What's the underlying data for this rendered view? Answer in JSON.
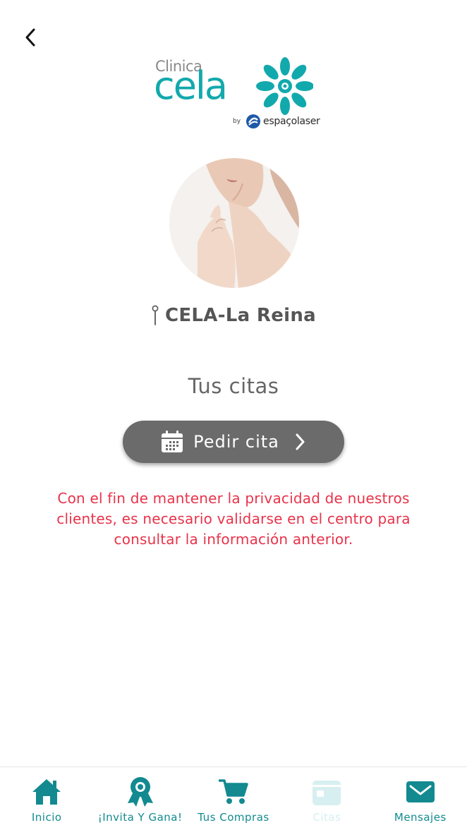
{
  "header": {
    "back_icon": "chevron-left-icon"
  },
  "logo": {
    "small_word": "Clinica",
    "big_word": "cela",
    "by": "by",
    "partner": "espaçolaser"
  },
  "clinic": {
    "pin_icon": "map-pin-icon",
    "name": "CELA-La Reina"
  },
  "appointments": {
    "title": "Tus citas",
    "button_label": "Pedir cita",
    "button_icon": "calendar-icon",
    "notice": "Con el fin de mantener la privacidad de nuestros clientes, es necesario validarse en el centro para consultar la información anterior."
  },
  "tabs": [
    {
      "label": "Inicio",
      "icon": "home-icon"
    },
    {
      "label": "¡Invita Y Gana!",
      "icon": "award-icon"
    },
    {
      "label": "Tus Compras",
      "icon": "cart-icon"
    },
    {
      "label": "Citas",
      "icon": "calendar-icon",
      "active": true
    },
    {
      "label": "Mensajes",
      "icon": "mail-icon"
    }
  ],
  "colors": {
    "brand_teal": "#12a9ad",
    "tab_teal": "#128a90",
    "notice_red": "#e8334a",
    "button_gray": "#6b6b6b"
  }
}
